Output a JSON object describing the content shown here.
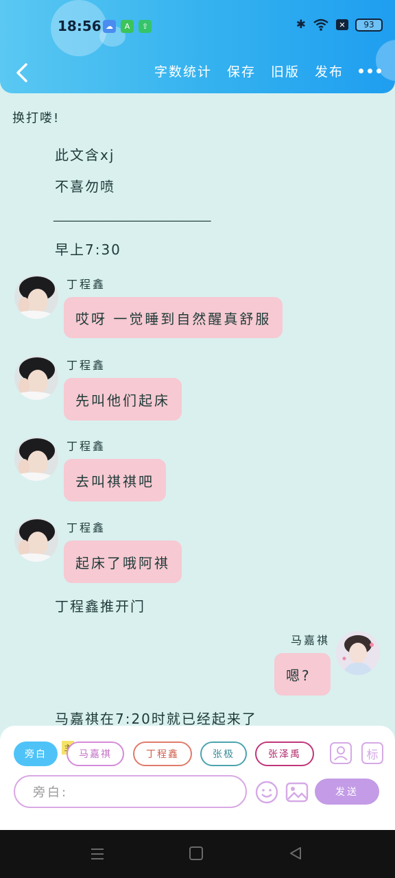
{
  "status_bar": {
    "time": "18:56",
    "app_icons": [
      {
        "icon": "cloud-icon",
        "color": "#4a8cf0",
        "glyph": "☁"
      },
      {
        "icon": "a-app-icon",
        "color": "#3cc35a",
        "glyph": "A"
      },
      {
        "icon": "upload-icon",
        "color": "#35c46a",
        "glyph": "⇧"
      }
    ],
    "bluetooth": "✱",
    "wifi": "wifi-icon",
    "x_label": "✕",
    "battery": "93"
  },
  "toolbar": {
    "actions": [
      "字数统计",
      "保存",
      "旧版",
      "发布"
    ],
    "more": "more-icon"
  },
  "chat": {
    "intro": "换打喽!",
    "note_1": "此文含xj",
    "note_2": "不喜勿喷",
    "divider": "___________________________",
    "time_note": "早上7:30",
    "messages": [
      {
        "name": "丁程鑫",
        "text": "哎呀 一觉睡到自然醒真舒服"
      },
      {
        "name": "丁程鑫",
        "text": "先叫他们起床"
      },
      {
        "name": "丁程鑫",
        "text": "去叫祺祺吧"
      },
      {
        "name": "丁程鑫",
        "text": "起床了哦阿祺"
      }
    ],
    "narration_1": "丁程鑫推开门",
    "right_message": {
      "name": "马嘉祺",
      "text": "嗯?"
    },
    "narration_2": "马嘉祺在7:20时就已经起来了"
  },
  "input_panel": {
    "chips": [
      {
        "label": "旁白",
        "color": "#4fc3f7",
        "filled": true
      },
      {
        "label": "马嘉祺",
        "color": "#d58ad8",
        "filled": false
      },
      {
        "label": "丁程鑫",
        "color": "#e07a6a",
        "filled": false
      },
      {
        "label": "张极",
        "color": "#4aa3b0",
        "filled": false
      },
      {
        "label": "张泽禹",
        "color": "#c0357a",
        "filled": false
      }
    ],
    "main_tag": "主",
    "side_icon_person": "person-card-icon",
    "side_icon_tag": "标",
    "placeholder": "旁白:",
    "send_label": "发送"
  },
  "colors": {
    "accent": "#33b1ef",
    "bubble": "#f7c9d2",
    "background": "#d9f0ef",
    "send": "#c39be6"
  }
}
